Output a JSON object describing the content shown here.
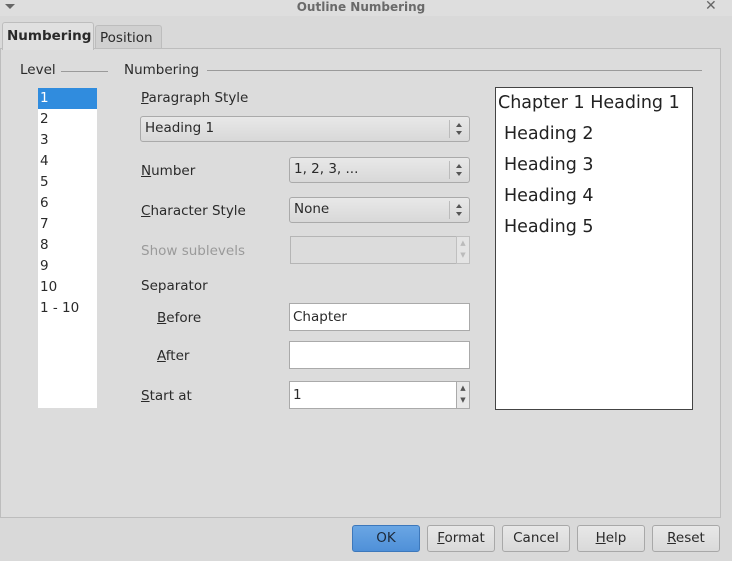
{
  "window": {
    "title": "Outline Numbering"
  },
  "tabs": [
    {
      "label": "Numbering",
      "active": true
    },
    {
      "label": "Position",
      "active": false
    }
  ],
  "level": {
    "legend": "Level",
    "items": [
      "1",
      "2",
      "3",
      "4",
      "5",
      "6",
      "7",
      "8",
      "9",
      "10",
      "1 - 10"
    ],
    "selected": "1"
  },
  "numbering": {
    "legend": "Numbering",
    "paragraph_style_label": "Paragraph Style",
    "paragraph_style_value": "Heading 1",
    "number_label": "Number",
    "number_value": "1, 2, 3, ...",
    "character_style_label": "Character Style",
    "character_style_value": "None",
    "show_sublevels_label": "Show sublevels",
    "show_sublevels_value": "",
    "separator_label": "Separator",
    "before_label": "Before",
    "before_value": "Chapter",
    "after_label": "After",
    "after_value": "",
    "start_at_label": "Start at",
    "start_at_value": "1"
  },
  "preview": [
    "Chapter 1 Heading 1",
    "Heading 2",
    "Heading 3",
    "Heading 4",
    "Heading 5"
  ],
  "buttons": {
    "ok": "OK",
    "format": "Format",
    "cancel": "Cancel",
    "help": "Help",
    "reset": "Reset"
  },
  "colors": {
    "selection": "#308cde",
    "ok_button": "#5b9be0"
  }
}
